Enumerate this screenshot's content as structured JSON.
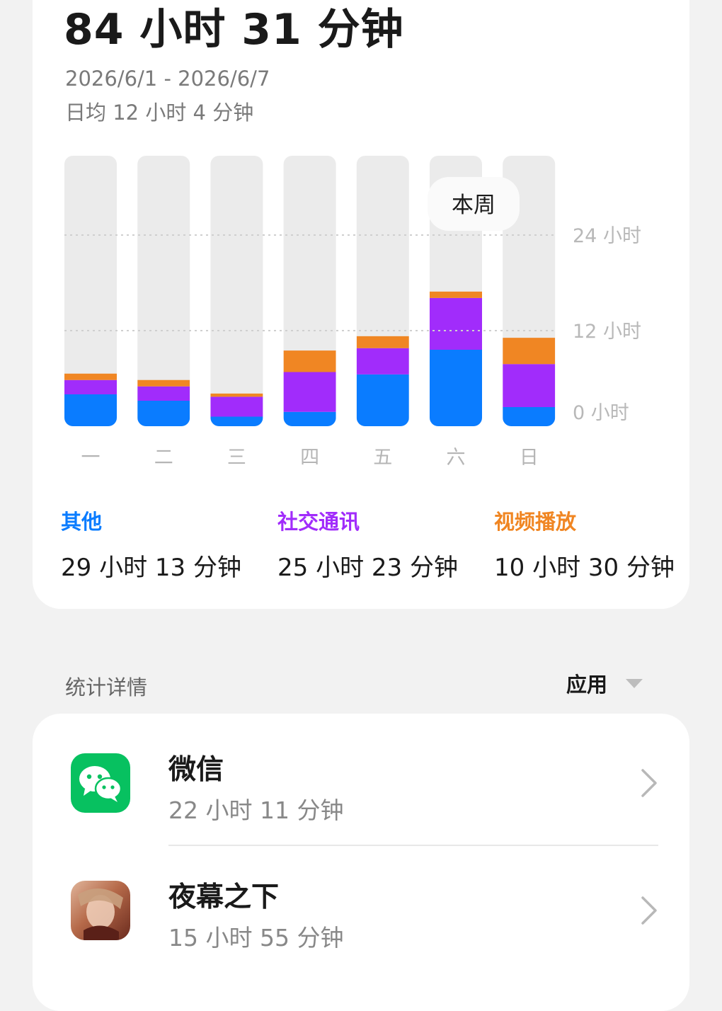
{
  "summary": {
    "total": "84 小时 31 分钟",
    "date_range": "2026/6/1 - 2026/6/7",
    "daily_average": "日均 12 小时 4 分钟"
  },
  "chart_data": {
    "type": "bar",
    "stacked": true,
    "categories": [
      "一",
      "二",
      "三",
      "四",
      "五",
      "六",
      "日"
    ],
    "y_tick_labels": [
      "0 小时",
      "12 小时",
      "24 小时"
    ],
    "ylim": [
      0,
      24
    ],
    "series": [
      {
        "name": "其他",
        "color": "#0a7cff",
        "values": [
          4.0,
          3.2,
          1.2,
          1.8,
          6.5,
          9.6,
          2.4
        ]
      },
      {
        "name": "社交通讯",
        "color": "#a12cfb",
        "values": [
          1.8,
          1.8,
          2.5,
          5.0,
          3.3,
          6.5,
          5.4
        ]
      },
      {
        "name": "视频播放",
        "color": "#f08623",
        "values": [
          0.8,
          0.8,
          0.4,
          2.7,
          1.5,
          0.8,
          3.3
        ]
      }
    ],
    "track_color": "#ebebeb",
    "highlight_label": "本周",
    "highlight_category": "六",
    "grid": true
  },
  "legend": [
    {
      "name": "其他",
      "value": "29 小时 13 分钟",
      "color": "#0a7cff"
    },
    {
      "name": "社交通讯",
      "value": "25 小时 23 分钟",
      "color": "#a12cfb"
    },
    {
      "name": "视频播放",
      "value": "10 小时 30 分钟",
      "color": "#f08623"
    }
  ],
  "details": {
    "title": "统计详情",
    "sort_label": "应用"
  },
  "apps": [
    {
      "name": "微信",
      "time": "22 小时 11 分钟",
      "icon": "wechat-icon"
    },
    {
      "name": "夜幕之下",
      "time": "15 小时 55 分钟",
      "icon": "game-icon"
    }
  ]
}
